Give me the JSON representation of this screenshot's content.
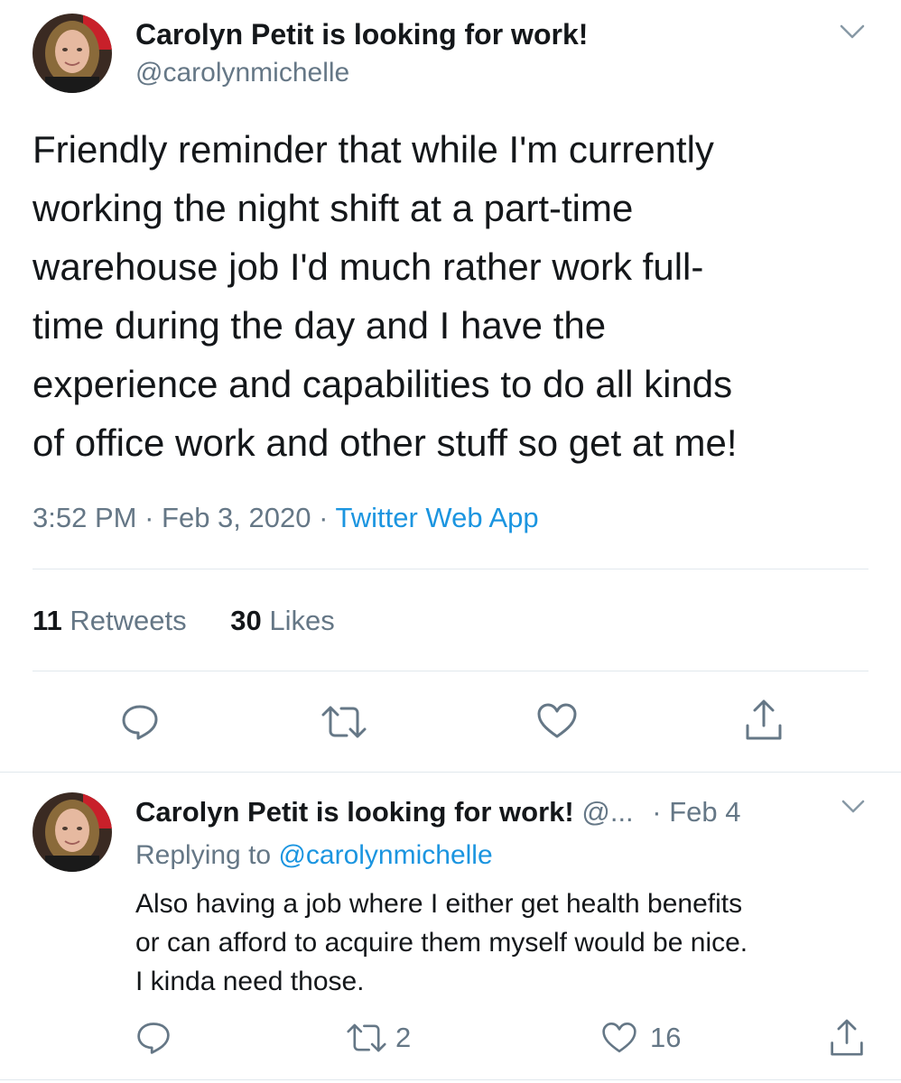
{
  "main_tweet": {
    "display_name": "Carolyn Petit is looking for work!",
    "handle": "@carolynmichelle",
    "text_lines": [
      "Friendly reminder that while I'm currently",
      "working the night shift at a part-time",
      "warehouse job I'd much rather work full-",
      "time during the day and I have the",
      "experience and capabilities to do all kinds",
      "of office work and other stuff so get at me!"
    ],
    "time": "3:52 PM",
    "sep1": "·",
    "date": "Feb 3, 2020",
    "sep2": "·",
    "source": "Twitter Web App",
    "retweets_count": "11",
    "retweets_label": "Retweets",
    "likes_count": "30",
    "likes_label": "Likes",
    "icons": [
      "reply-icon",
      "retweet-icon",
      "like-icon",
      "share-icon",
      "chevron-down-icon"
    ]
  },
  "reply_tweet": {
    "display_name": "Carolyn Petit is looking for work!",
    "handle_truncated": "@...",
    "sep": "·",
    "date": "Feb 4",
    "replying_prefix": "Replying to",
    "replying_handle": "@carolynmichelle",
    "text_lines": [
      "Also having a job where I either get health benefits",
      "or can afford to acquire them myself would be nice.",
      "I kinda need those."
    ],
    "retweet_count": "2",
    "like_count": "16",
    "icons": [
      "reply-icon",
      "retweet-icon",
      "like-icon",
      "share-icon",
      "chevron-down-icon"
    ]
  },
  "colors": {
    "text": "#14171a",
    "muted": "#657786",
    "link": "#1b95e0",
    "divider": "#e1e8ed"
  }
}
